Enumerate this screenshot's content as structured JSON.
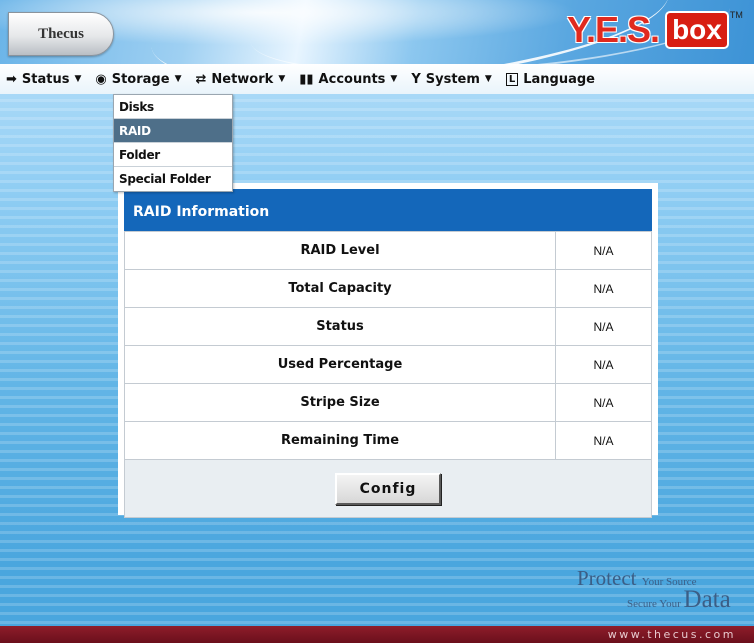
{
  "header": {
    "brand_left": "Thecus",
    "brand_right_yes": "Y.E.S.",
    "brand_right_box": "box",
    "brand_right_tm": "TM"
  },
  "menu": {
    "items": [
      {
        "label": "Status",
        "icon": "status-icon",
        "glyph": "➡"
      },
      {
        "label": "Storage",
        "icon": "storage-icon",
        "glyph": "◉"
      },
      {
        "label": "Network",
        "icon": "network-icon",
        "glyph": "⇄"
      },
      {
        "label": "Accounts",
        "icon": "accounts-icon",
        "glyph": "▮▮"
      },
      {
        "label": "System",
        "icon": "system-icon",
        "glyph": "Y"
      },
      {
        "label": "Language",
        "icon": "language-icon",
        "glyph": "L"
      }
    ],
    "arrow": "▼"
  },
  "storage_dropdown": {
    "items": [
      "Disks",
      "RAID",
      "Folder",
      "Special Folder"
    ],
    "active": "RAID"
  },
  "panel": {
    "title": "RAID Information",
    "rows": [
      {
        "label": "RAID Level",
        "value": "N/A"
      },
      {
        "label": "Total Capacity",
        "value": "N/A"
      },
      {
        "label": "Status",
        "value": "N/A"
      },
      {
        "label": "Used Percentage",
        "value": "N/A"
      },
      {
        "label": "Stripe Size",
        "value": "N/A"
      },
      {
        "label": "Remaining Time",
        "value": "N/A"
      }
    ],
    "config_button": "Config"
  },
  "slogan": {
    "protect": "Protect",
    "your_source": "Your Source",
    "secure_your": "Secure Your",
    "data": "Data"
  },
  "footer": {
    "url": "www.thecus.com"
  },
  "colors": {
    "panel_title_bg": "#1467ba",
    "dropdown_active_bg": "#4e6f89",
    "footer_bg": "#7a1422",
    "logo_red": "#e02a1e"
  }
}
